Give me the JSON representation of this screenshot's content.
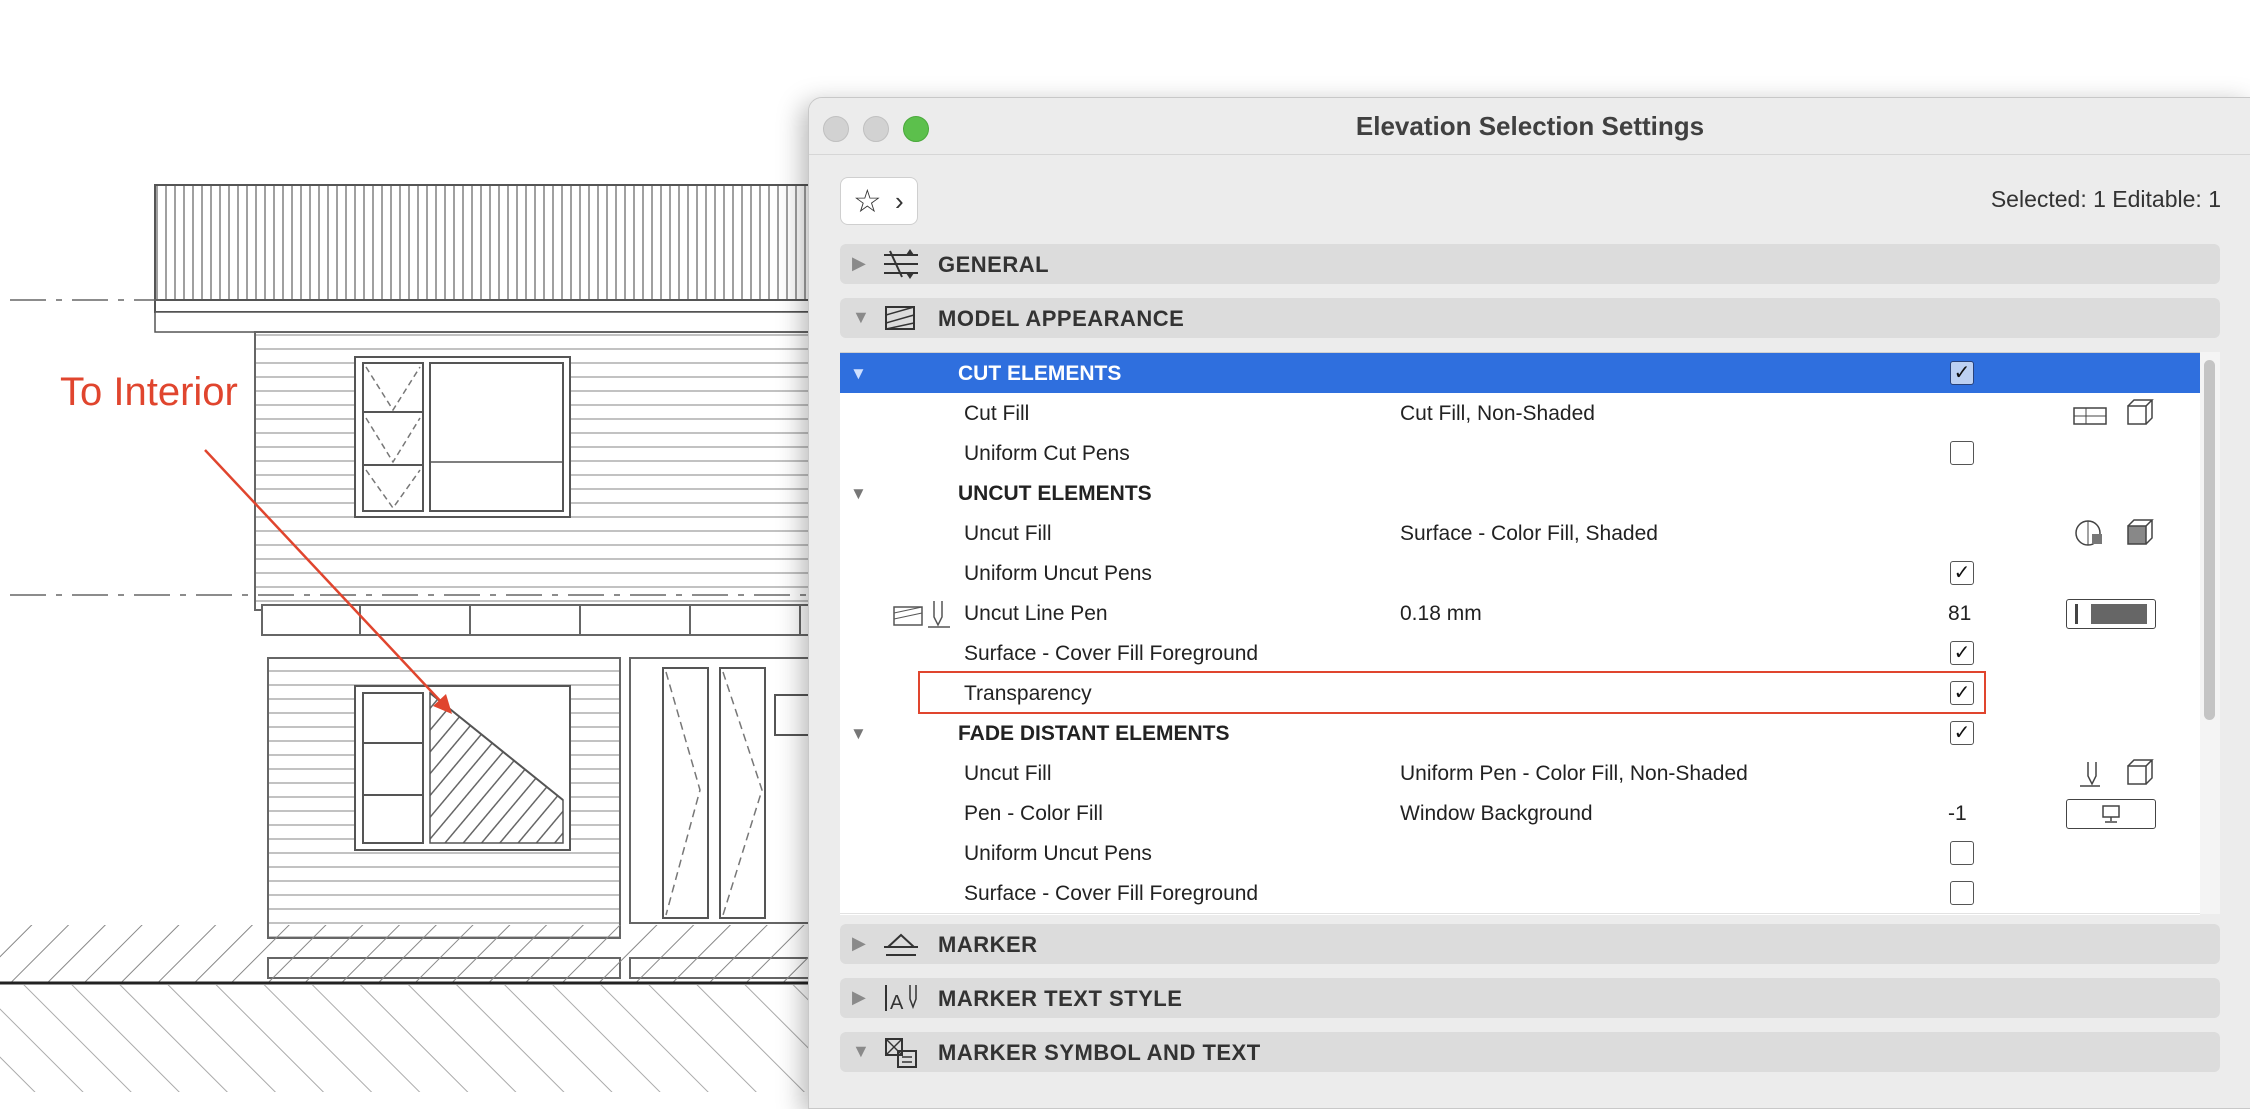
{
  "annotation": {
    "label": "To Interior",
    "color": "#e0452e"
  },
  "dialog": {
    "title": "Elevation Selection Settings",
    "status": "Selected: 1 Editable: 1",
    "accent": "#2f6fde"
  },
  "panels": {
    "general": "GENERAL",
    "model_appearance": "MODEL APPEARANCE",
    "marker": "MARKER",
    "marker_text_style": "MARKER TEXT STYLE",
    "marker_symbol_and_text": "MARKER SYMBOL AND TEXT"
  },
  "tree": {
    "cut_elements": {
      "label": "CUT ELEMENTS",
      "checked": true
    },
    "cut_fill": {
      "name": "Cut Fill",
      "value": "Cut Fill, Non-Shaded"
    },
    "uniform_cut_pens": {
      "name": "Uniform Cut Pens",
      "checked": false
    },
    "uncut_elements": {
      "label": "UNCUT ELEMENTS"
    },
    "uncut_fill": {
      "name": "Uncut Fill",
      "value": "Surface - Color Fill, Shaded"
    },
    "uniform_uncut_pens": {
      "name": "Uniform Uncut Pens",
      "checked": true
    },
    "uncut_line_pen": {
      "name": "Uncut Line Pen",
      "value": "0.18 mm",
      "number": "81"
    },
    "surface_cover_fill": {
      "name": "Surface - Cover Fill Foreground",
      "checked": true
    },
    "transparency": {
      "name": "Transparency",
      "checked": true
    },
    "fade_distant": {
      "label": "FADE DISTANT ELEMENTS",
      "checked": true
    },
    "fade_uncut_fill": {
      "name": "Uncut Fill",
      "value": "Uniform Pen - Color Fill, Non-Shaded"
    },
    "pen_color_fill": {
      "name": "Pen - Color Fill",
      "value": "Window Background",
      "number": "-1"
    },
    "fade_uniform_uncut_pens": {
      "name": "Uniform Uncut Pens",
      "checked": false
    },
    "fade_surface_cover_fill": {
      "name": "Surface - Cover Fill Foreground",
      "checked": false
    }
  }
}
